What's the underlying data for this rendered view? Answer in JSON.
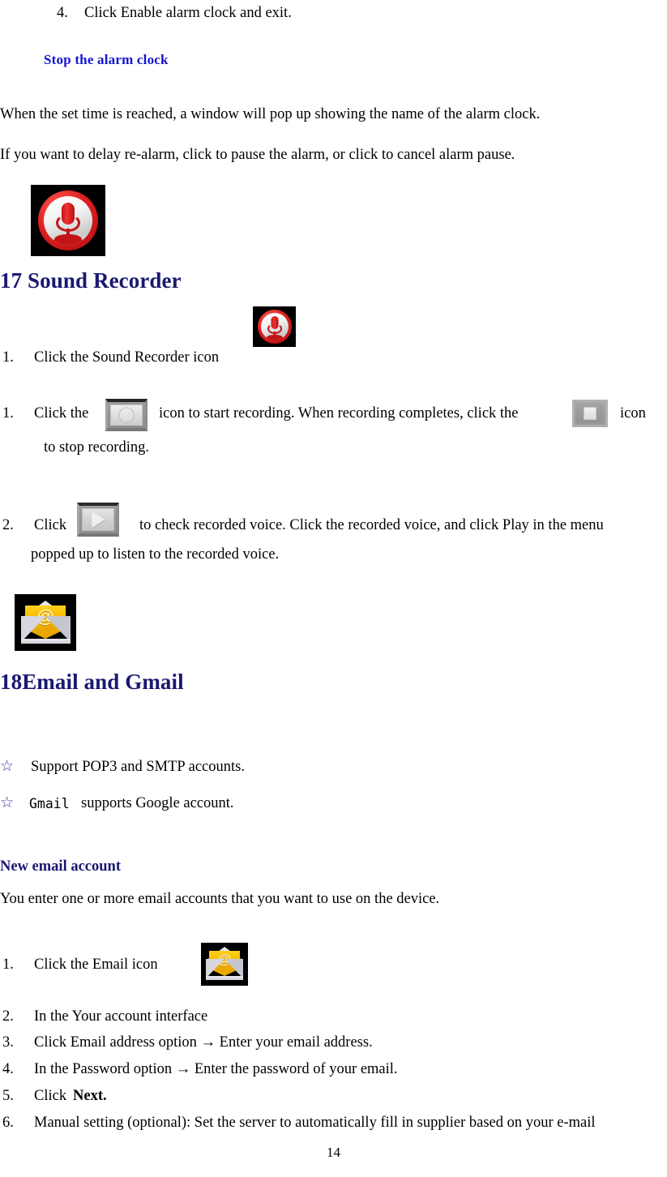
{
  "document": {
    "page_number": "14"
  },
  "alarm_section": {
    "step4_number": "4.",
    "step4_text": "Click Enable alarm clock and exit.",
    "heading": "Stop the alarm clock",
    "para1": "When the set time is reached, a window will pop up showing the name of the alarm clock.",
    "para2": "If you want to delay re-alarm, click to pause the alarm, or click to cancel alarm pause."
  },
  "sound_recorder": {
    "icon_name": "sound-recorder-icon",
    "heading": "17 Sound Recorder",
    "steps": [
      {
        "number": "1.",
        "text_before": "Click the Sound Recorder icon",
        "text_after": ""
      },
      {
        "number": "1.",
        "text_before": "Click the",
        "text_mid": "icon to start recording. When recording completes, click the",
        "text_after": "icon",
        "text_cont": "to stop recording."
      },
      {
        "number": "2.",
        "text_before": "Click",
        "text_after": "to check recorded voice. Click the recorded voice, and click Play in the menu",
        "text_cont": "popped up to listen to the recorded voice."
      }
    ]
  },
  "email_section": {
    "icon_name": "email-icon",
    "heading": "18Email and Gmail",
    "bullets": [
      {
        "marker": "☆",
        "text": "Support POP3 and SMTP accounts."
      },
      {
        "marker": "☆",
        "text_mono": "Gmail",
        "text": "supports Google account."
      }
    ],
    "sub_heading": "New email account",
    "intro": "You enter one or more email accounts that you want to use on the device.",
    "steps": [
      {
        "number": "1.",
        "text": "Click the Email icon"
      },
      {
        "number": "2.",
        "text": "In the Your account interface"
      },
      {
        "number": "3.",
        "text": "Click Email address option → Enter your email address."
      },
      {
        "number": "4.",
        "text": "In the Password option → Enter the password of your email."
      },
      {
        "number": "5.",
        "text_before": "Click",
        "text_bold": "Next."
      },
      {
        "number": "6.",
        "text": "Manual setting (optional): Set the server to automatically fill in supplier based on your e-mail"
      }
    ]
  },
  "colors": {
    "heading_blue": "#1414d2",
    "heading_navy": "#191970",
    "star_marker": "#3b3b9e",
    "icon_red": "#c21414",
    "icon_gold": "#f6b800",
    "icon_tile_bg": "#000000"
  }
}
